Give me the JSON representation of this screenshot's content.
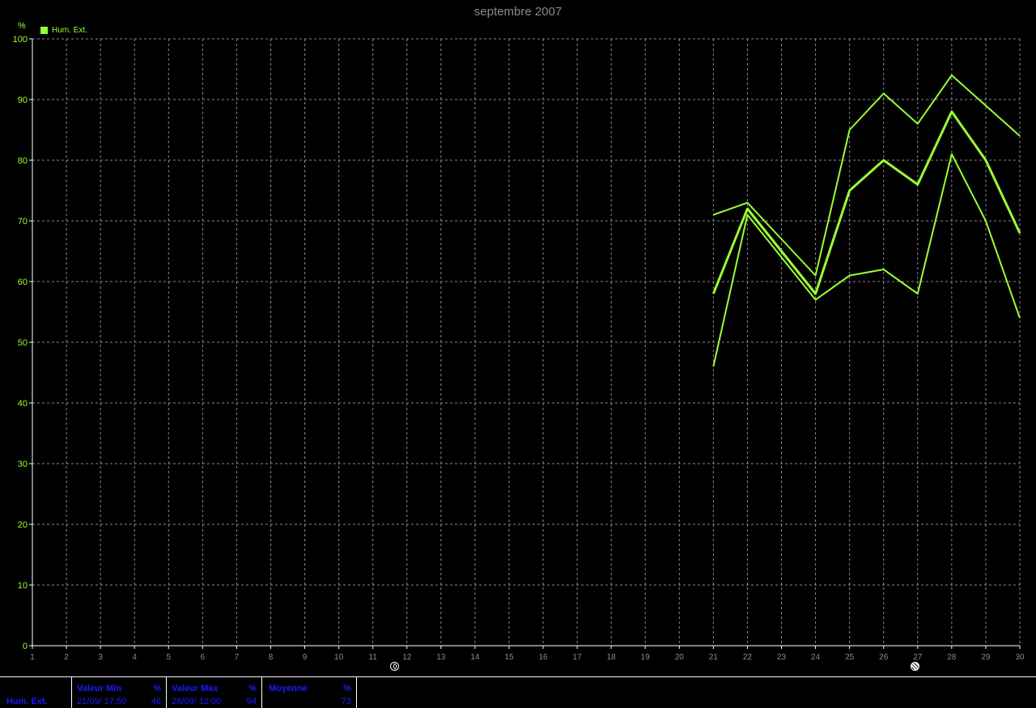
{
  "title": "septembre 2007",
  "unit": "%",
  "legend": {
    "label": "Hum. Ext.",
    "color": "#99ff33"
  },
  "chart_data": {
    "type": "line",
    "title": "septembre 2007",
    "xlabel": "",
    "ylabel": "%",
    "x": [
      1,
      2,
      3,
      4,
      5,
      6,
      7,
      8,
      9,
      10,
      11,
      12,
      13,
      14,
      15,
      16,
      17,
      18,
      19,
      20,
      21,
      22,
      23,
      24,
      25,
      26,
      27,
      28,
      29,
      30
    ],
    "xlim": [
      1,
      30
    ],
    "ylim": [
      0,
      100
    ],
    "yticks": [
      0,
      10,
      20,
      30,
      40,
      50,
      60,
      70,
      80,
      90,
      100
    ],
    "grid": true,
    "legend_position": "top-left",
    "series": [
      {
        "name": "Hum. Ext.",
        "role": "max",
        "x": [
          21,
          22,
          23,
          24,
          25,
          26,
          27,
          28,
          29,
          30
        ],
        "values": [
          71,
          73,
          67,
          61,
          85,
          91,
          86,
          94,
          89,
          84
        ]
      },
      {
        "name": "Hum. Ext.",
        "role": "mean",
        "x": [
          21,
          22,
          23,
          24,
          25,
          26,
          27,
          28,
          29,
          30
        ],
        "values": [
          58,
          72,
          65,
          58,
          75,
          80,
          76,
          88,
          80,
          68
        ]
      },
      {
        "name": "Hum. Ext.",
        "role": "min",
        "x": [
          21,
          22,
          23,
          24,
          25,
          26,
          27,
          28,
          29,
          30
        ],
        "values": [
          46,
          71,
          64,
          57,
          61,
          62,
          58,
          81,
          70,
          54
        ]
      }
    ],
    "colors": {
      "background": "#000000",
      "line": "#99ff33",
      "grid": "#8a8a8a",
      "axis_text": "#99ff33"
    }
  },
  "stats": {
    "row_label": "Hum. Ext.",
    "min": {
      "header": "Valeur Min",
      "unit": "%",
      "when": "21/09/ 17:50",
      "value": "46"
    },
    "max": {
      "header": "Valeur Max",
      "unit": "%",
      "when": "28/09/ 12:00",
      "value": "94"
    },
    "mean": {
      "header": "Moyenne",
      "unit": "%",
      "value": "73"
    }
  }
}
